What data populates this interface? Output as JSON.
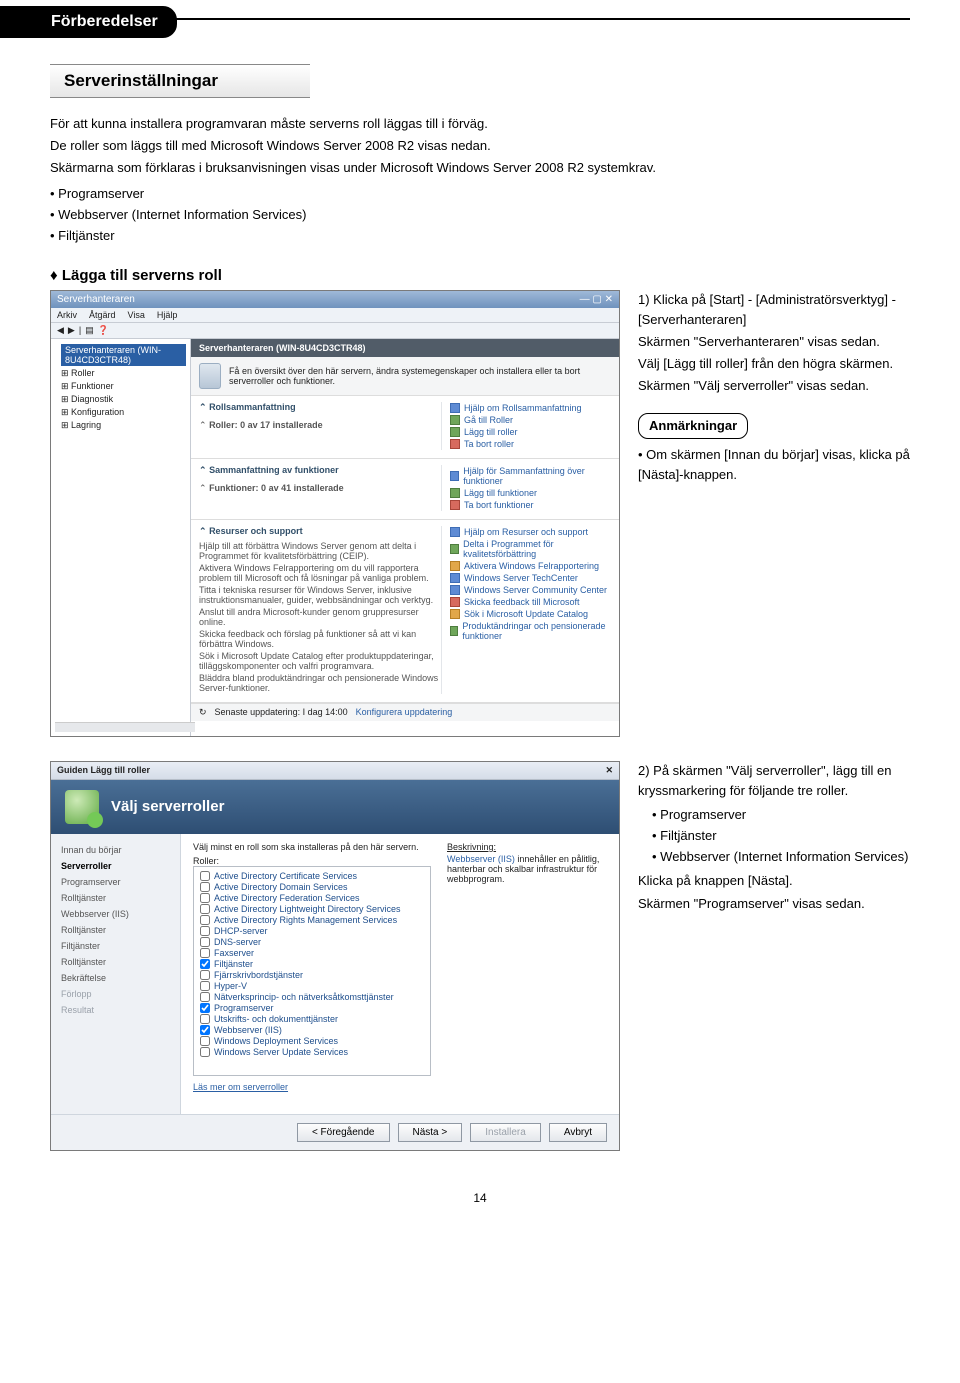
{
  "header": {
    "tab": "Förberedelser"
  },
  "section_title": "Serverinställningar",
  "intro": {
    "p1": "För att kunna installera programvaran måste serverns roll läggas till i förväg.",
    "p2": "De roller som läggs till med Microsoft Windows Server 2008 R2 visas nedan.",
    "p3": "Skärmarna som förklaras i bruksanvisningen visas under Microsoft Windows Server 2008 R2 systemkrav."
  },
  "intro_bullets": [
    "Programserver",
    "Webbserver (Internet Information Services)",
    "Filtjänster"
  ],
  "diamond": "Lägga till serverns roll",
  "step1": {
    "l1": "1) Klicka på [Start] - [Administratörsverktyg] - [Serverhanteraren]",
    "l2": "Skärmen \"Serverhanteraren\" visas sedan.",
    "l3": "Välj [Lägg till roller] från den högra skärmen.",
    "l4": "Skärmen \"Välj serverroller\" visas sedan."
  },
  "notes_label": "Anmärkningar",
  "notes": [
    "Om skärmen [Innan du börjar] visas, klicka på [Nästa]-knappen."
  ],
  "step2": {
    "l1": "2) På skärmen \"Välj serverroller\", lägg till en kryssmarkering för följande tre roller.",
    "bullets": [
      "Programserver",
      "Filtjänster",
      "Webbserver (Internet Information Services)"
    ],
    "l2": "Klicka på knappen [Nästa].",
    "l3": "Skärmen \"Programserver\" visas sedan."
  },
  "sm": {
    "title": "Serverhanteraren",
    "menu": [
      "Arkiv",
      "Åtgärd",
      "Visa",
      "Hjälp"
    ],
    "tree_root": "Serverhanteraren (WIN-8U4CD3CTR48)",
    "tree": [
      "Roller",
      "Funktioner",
      "Diagnostik",
      "Konfiguration",
      "Lagring"
    ],
    "crumb": "Serverhanteraren (WIN-8U4CD3CTR48)",
    "info": "Få en översikt över den här servern, ändra systemegenskaper och installera eller ta bort serverroller och funktioner.",
    "sec_roles_title": "Rollsammanfattning",
    "sec_roles_line": "Roller: 0 av 17 installerade",
    "sec_roles_links": [
      "Hjälp om Rollsammanfattning",
      "Gå till Roller",
      "Lägg till roller",
      "Ta bort roller"
    ],
    "sec_feat_title": "Sammanfattning av funktioner",
    "sec_feat_line": "Funktioner: 0 av 41 installerade",
    "sec_feat_links": [
      "Hjälp för Sammanfattning över funktioner",
      "Lägg till funktioner",
      "Ta bort funktioner"
    ],
    "sec_res_title": "Resurser och support",
    "sec_res_lines": [
      "Hjälp till att förbättra Windows Server genom att delta i Programmet för kvalitetsförbättring (CEIP).",
      "Aktivera Windows Felrapportering om du vill rapportera problem till Microsoft och få lösningar på vanliga problem.",
      "Titta i tekniska resurser för Windows Server, inklusive instruktionsmanualer, guider, webbsändningar och verktyg.",
      "Anslut till andra Microsoft-kunder genom gruppresurser online.",
      "Skicka feedback och förslag på funktioner så att vi kan förbättra Windows.",
      "Sök i Microsoft Update Catalog efter produktuppdateringar, tilläggskomponenter och valfri programvara.",
      "Bläddra bland produktändringar och pensionerade Windows Server-funktioner."
    ],
    "sec_res_links": [
      "Hjälp om Resurser och support",
      "Delta i Programmet för kvalitetsförbättring",
      "Aktivera Windows Felrapportering",
      "Windows Server TechCenter",
      "Windows Server Community Center",
      "Skicka feedback till Microsoft",
      "Sök i Microsoft Update Catalog",
      "Produktändringar och pensionerade funktioner"
    ],
    "footer_refresh": "Senaste uppdatering: I dag 14:00",
    "footer_link": "Konfigurera uppdatering"
  },
  "wiz": {
    "title": "Guiden Lägg till roller",
    "heading": "Välj serverroller",
    "nav": [
      "Innan du börjar",
      "Serverroller",
      "Programserver",
      "Rolltjänster",
      "Webbserver (IIS)",
      "Rolltjänster",
      "Filtjänster",
      "Rolltjänster",
      "Bekräftelse",
      "Förlopp",
      "Resultat"
    ],
    "nav_on_index": 1,
    "instr": "Välj minst en roll som ska installeras på den här servern.",
    "roles_label": "Roller:",
    "desc_label": "Beskrivning:",
    "desc_link": "Webbserver (IIS)",
    "desc_text": " innehåller en pålitlig, hanterbar och skalbar infrastruktur för webbprogram.",
    "roles": [
      {
        "label": "Active Directory Certificate Services",
        "checked": false
      },
      {
        "label": "Active Directory Domain Services",
        "checked": false
      },
      {
        "label": "Active Directory Federation Services",
        "checked": false
      },
      {
        "label": "Active Directory Lightweight Directory Services",
        "checked": false
      },
      {
        "label": "Active Directory Rights Management Services",
        "checked": false
      },
      {
        "label": "DHCP-server",
        "checked": false
      },
      {
        "label": "DNS-server",
        "checked": false
      },
      {
        "label": "Faxserver",
        "checked": false
      },
      {
        "label": "Filtjänster",
        "checked": true
      },
      {
        "label": "Fjärrskrivbordstjänster",
        "checked": false
      },
      {
        "label": "Hyper-V",
        "checked": false
      },
      {
        "label": "Nätverksprincip- och nätverksåtkomsttjänster",
        "checked": false
      },
      {
        "label": "Programserver",
        "checked": true
      },
      {
        "label": "Utskrifts- och dokumenttjänster",
        "checked": false
      },
      {
        "label": "Webbserver (IIS)",
        "checked": true
      },
      {
        "label": "Windows Deployment Services",
        "checked": false
      },
      {
        "label": "Windows Server Update Services",
        "checked": false
      }
    ],
    "roles_more": "Läs mer om serverroller",
    "buttons": {
      "prev": "< Föregående",
      "next": "Nästa >",
      "install": "Installera",
      "cancel": "Avbryt"
    }
  },
  "page_number": "14"
}
